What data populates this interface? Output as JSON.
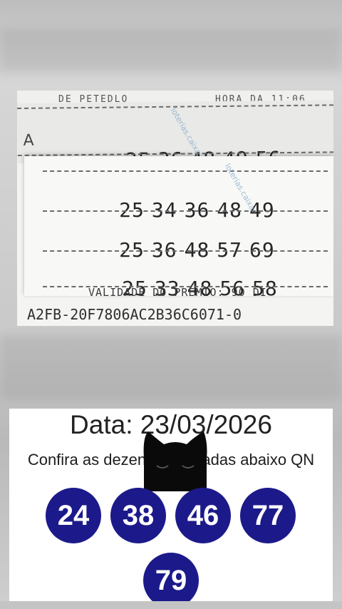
{
  "ticket": {
    "top_strip_left": "DE PETEDLO",
    "top_strip_right": "HORA DA  11:06",
    "row_marker": "A",
    "watermark_text": "loterias.caixa",
    "lines": [
      [
        "25",
        "36",
        "48",
        "49",
        "56"
      ],
      [
        "25",
        "34",
        "36",
        "48",
        "49"
      ],
      [
        "25",
        "36",
        "48",
        "57",
        "69"
      ],
      [
        "25",
        "33",
        "48",
        "56",
        "58"
      ]
    ],
    "validade_text": "VALIDADE DO PREMIO: 90 DI",
    "code": "A2FB-20F7806AC2B36C6071-0"
  },
  "result": {
    "date_text": "Data: 23/03/2026",
    "subtitle": "Confira as dezenas sorteadas abaixo QN",
    "numbers": [
      "24",
      "38",
      "46",
      "77",
      "79"
    ],
    "ball_color": "#1c1a8a"
  },
  "overlay": {
    "icon": "black-cat-icon"
  }
}
